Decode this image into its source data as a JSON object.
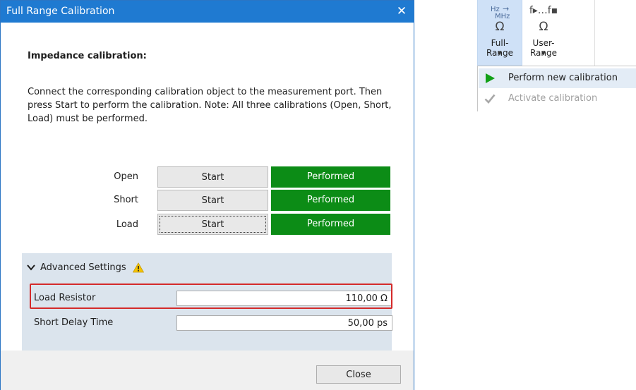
{
  "dialog": {
    "title": "Full Range Calibration",
    "heading": "Impedance calibration:",
    "description": "Connect the corresponding calibration object to the measurement port. Then press Start to perform the calibration. Note: All three calibrations (Open, Short, Load) must be performed.",
    "calibrations": [
      {
        "label": "Open",
        "button": "Start",
        "status": "Performed"
      },
      {
        "label": "Short",
        "button": "Start",
        "status": "Performed"
      },
      {
        "label": "Load",
        "button": "Start",
        "status": "Performed"
      }
    ],
    "advanced": {
      "label": "Advanced Settings",
      "expanded": true,
      "warning_icon": "warning-icon",
      "params": [
        {
          "label": "Load Resistor",
          "value": "110,00 Ω"
        },
        {
          "label": "Short Delay Time",
          "value": "50,00 ps"
        }
      ]
    },
    "close_label": "Close"
  },
  "ribbon": {
    "full_range": {
      "icon_top": "Hz",
      "icon_unit": "MHz",
      "omega": "Ω",
      "label": "Full-Range"
    },
    "user_range": {
      "icon_top": "f▸…f▪",
      "omega": "Ω",
      "label": "User-Range"
    }
  },
  "menu": {
    "items": [
      {
        "label": "Perform new calibration",
        "enabled": true,
        "icon": "play-icon"
      },
      {
        "label": "Activate calibration",
        "enabled": false,
        "icon": "checkmark-icon"
      }
    ]
  },
  "colors": {
    "titlebar": "#1f7ad1",
    "performed": "#0c8c16",
    "advanced_panel": "#dbe4ed",
    "highlight": "#d42a2a",
    "ribbon_active": "#cfe1f7"
  }
}
